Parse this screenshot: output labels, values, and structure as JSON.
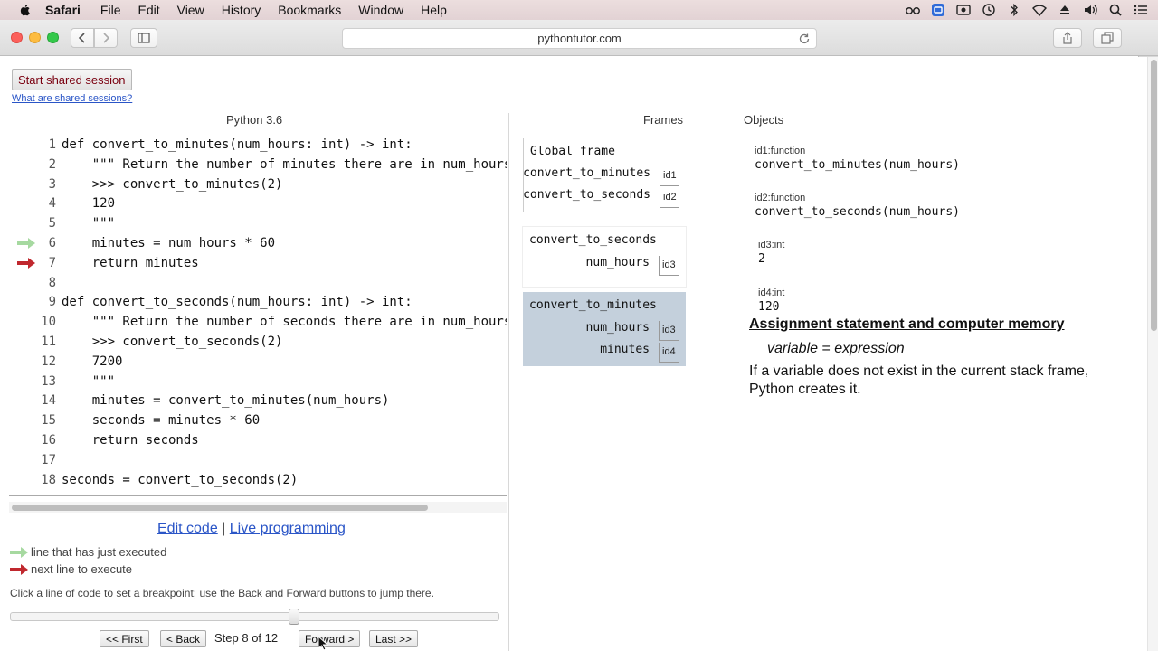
{
  "menubar": {
    "app": "Safari",
    "items": [
      "File",
      "Edit",
      "View",
      "History",
      "Bookmarks",
      "Window",
      "Help"
    ],
    "status_icons": [
      "glasses-icon",
      "accessibility-icon",
      "screen-capture-icon",
      "time-machine-icon",
      "bluetooth-icon",
      "wifi-icon",
      "eject-icon",
      "volume-icon",
      "spotlight-icon",
      "notification-center-icon"
    ]
  },
  "browser": {
    "url": "pythontutor.com"
  },
  "share": {
    "button_label": "Start shared session",
    "link_label": "What are shared sessions?"
  },
  "editor": {
    "language": "Python 3.6",
    "lines": [
      {
        "n": "1",
        "text": "def convert_to_minutes(num_hours: int) -> int:"
      },
      {
        "n": "2",
        "text": "    \"\"\" Return the number of minutes there are in num_hours hours."
      },
      {
        "n": "3",
        "text": "    >>> convert_to_minutes(2)"
      },
      {
        "n": "4",
        "text": "    120"
      },
      {
        "n": "5",
        "text": "    \"\"\""
      },
      {
        "n": "6",
        "text": "    minutes = num_hours * 60"
      },
      {
        "n": "7",
        "text": "    return minutes"
      },
      {
        "n": "8",
        "text": ""
      },
      {
        "n": "9",
        "text": "def convert_to_seconds(num_hours: int) -> int:"
      },
      {
        "n": "10",
        "text": "    \"\"\" Return the number of seconds there are in num_hours hours."
      },
      {
        "n": "11",
        "text": "    >>> convert_to_seconds(2)"
      },
      {
        "n": "12",
        "text": "    7200"
      },
      {
        "n": "13",
        "text": "    \"\"\""
      },
      {
        "n": "14",
        "text": "    minutes = convert_to_minutes(num_hours)"
      },
      {
        "n": "15",
        "text": "    seconds = minutes * 60"
      },
      {
        "n": "16",
        "text": "    return seconds"
      },
      {
        "n": "17",
        "text": ""
      },
      {
        "n": "18",
        "text": "seconds = convert_to_seconds(2)"
      }
    ],
    "just_executed_line": "6",
    "next_line": "7",
    "colors": {
      "just_executed": "#a6d9a0",
      "next": "#c0282e"
    }
  },
  "controls": {
    "edit_code": "Edit code",
    "separator": "|",
    "live_programming": "Live programming",
    "legend_executed": "line that has just executed",
    "legend_next": "next line to execute",
    "hint": "Click a line of code to set a breakpoint; use the Back and Forward buttons to jump there.",
    "first": "<< First",
    "back": "< Back",
    "step_text": "Step 8 of 12",
    "forward": "Forward >",
    "last": "Last >>",
    "step_fraction": 0.58
  },
  "viz": {
    "frames_header": "Frames",
    "objects_header": "Objects",
    "global_frame": {
      "title": "Global frame",
      "vars": [
        {
          "name": "convert_to_minutes",
          "ptr": "id1"
        },
        {
          "name": "convert_to_seconds",
          "ptr": "id2"
        }
      ]
    },
    "seconds_frame": {
      "title": "convert_to_seconds",
      "vars": [
        {
          "name": "num_hours",
          "ptr": "id3"
        }
      ]
    },
    "minutes_frame": {
      "title": "convert_to_minutes",
      "vars": [
        {
          "name": "num_hours",
          "ptr": "id3"
        },
        {
          "name": "minutes",
          "ptr": "id4"
        }
      ]
    },
    "objects": [
      {
        "id": "id1:function",
        "value": "convert_to_minutes(num_hours)"
      },
      {
        "id": "id2:function",
        "value": "convert_to_seconds(num_hours)"
      },
      {
        "id": "id3:int",
        "value": "2"
      },
      {
        "id": "id4:int",
        "value": "120"
      }
    ]
  },
  "note": {
    "title": "Assignment statement and computer memory",
    "formula_var": "variable",
    "formula_eq": " = ",
    "formula_expr": "expression",
    "body": "If a variable does not exist in the current stack frame, Python creates it."
  }
}
